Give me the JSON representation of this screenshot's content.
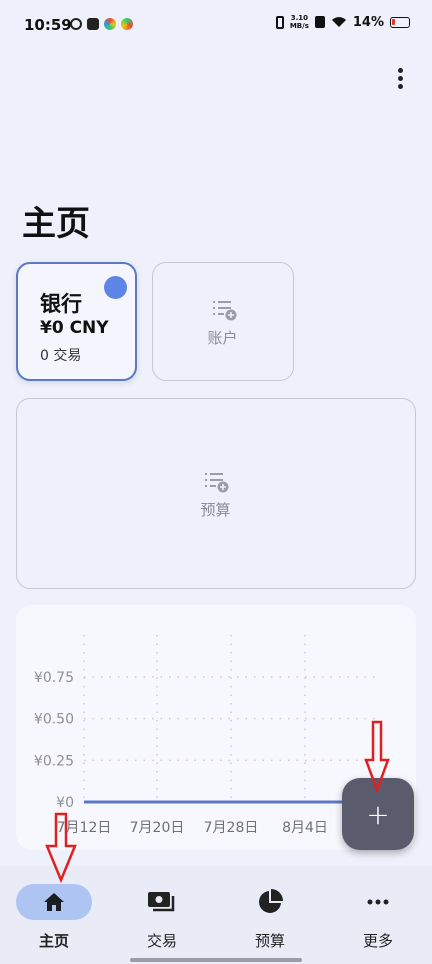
{
  "status_bar": {
    "time": "10:59",
    "net_speed_value": "3.10",
    "net_speed_unit": "MB/s",
    "battery": "14%"
  },
  "page": {
    "title": "主页"
  },
  "accounts": {
    "bank": {
      "name": "银行",
      "amount": "¥0 CNY",
      "transactions": "0 交易"
    },
    "add_account_label": "账户"
  },
  "budget": {
    "add_budget_label": "预算"
  },
  "chart_data": {
    "type": "line",
    "x": [
      "7月12日",
      "7月20日",
      "7月28日",
      "8月4日"
    ],
    "y_ticks": [
      "¥0",
      "¥0.25",
      "¥0.50",
      "¥0.75"
    ],
    "ylim": [
      0,
      0.75
    ],
    "series": [
      {
        "values": [
          0,
          0,
          0,
          0
        ],
        "color": "#5b79c7"
      }
    ],
    "grid": true
  },
  "fab": {
    "label": "+"
  },
  "nav": [
    {
      "label": "主页",
      "icon": "home-icon",
      "active": true
    },
    {
      "label": "交易",
      "icon": "transactions-icon",
      "active": false
    },
    {
      "label": "预算",
      "icon": "budget-pie-icon",
      "active": false
    },
    {
      "label": "更多",
      "icon": "more-icon",
      "active": false
    }
  ],
  "colors": {
    "accent": "#5b79c7",
    "nav_active": "#aec4f3",
    "fab": "#5a5c6e",
    "annotation": "#e02020"
  }
}
